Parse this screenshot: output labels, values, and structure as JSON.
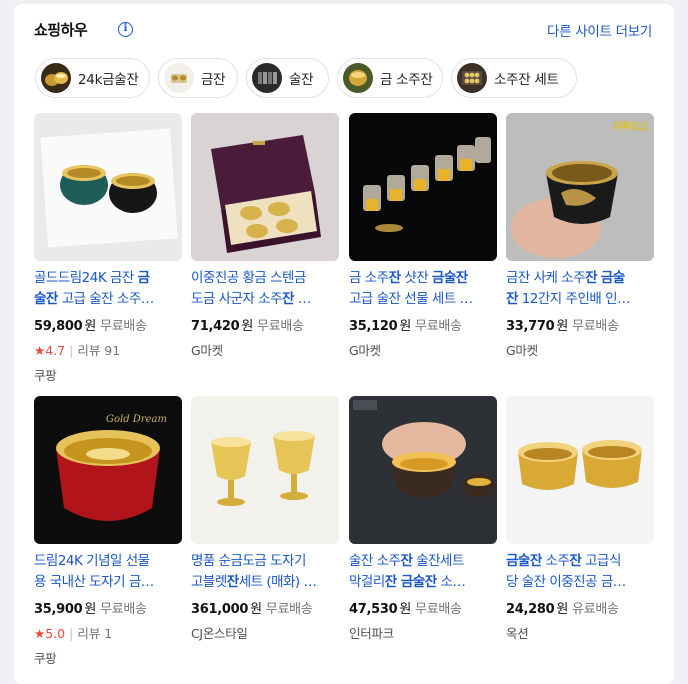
{
  "header": {
    "title": "쇼핑하우",
    "info_icon": "i",
    "more_link": "다른 사이트 더보기"
  },
  "chips": [
    {
      "label": "24k금술잔",
      "icon": "gold-cups-thumb"
    },
    {
      "label": "금잔",
      "icon": "gold-cup-thumb"
    },
    {
      "label": "술잔",
      "icon": "shot-glass-set-thumb"
    },
    {
      "label": "금 소주잔",
      "icon": "gold-soju-cup-thumb"
    },
    {
      "label": "소주잔 세트",
      "icon": "soju-set-box-thumb"
    }
  ],
  "products": [
    {
      "name_parts": [
        "골드드림24K 금잔 ",
        "금",
        "\n",
        "술잔",
        " 고급 술잔 소주잔"
      ],
      "name_line1_pre": "골드드림24K 금잔 ",
      "name_line1_bold": "금",
      "name_line2_bold": "술잔",
      "name_line2_post": " 고급 술잔 소주…",
      "price": "59,800",
      "won": "원",
      "shipping": "무료배송",
      "rating": "4.7",
      "reviews": "리뷰 91",
      "mall": "쿠팡"
    },
    {
      "name_line1_pre": "이중진공 황금 스텐금",
      "name_line1_bold": "",
      "name_line2_pre": "도금 사군자 소주",
      "name_line2_bold": "잔",
      "name_line2_post": " …",
      "price": "71,420",
      "won": "원",
      "shipping": "무료배송",
      "mall": "G마켓"
    },
    {
      "name_line1_pre": "금 소주",
      "name_line1_bold": "잔",
      "name_line1_mid": " 샷잔 ",
      "name_line1_bold2": "금술잔",
      "name_line2_post": "고급 술잔 선물 세트 …",
      "price": "35,120",
      "won": "원",
      "shipping": "무료배송",
      "mall": "G마켓"
    },
    {
      "name_line1_pre": "금잔 사케 소주",
      "name_line1_bold": "잔",
      "name_line1_mid": " ",
      "name_line1_bold2": "금술",
      "name_line2_bold": "잔",
      "name_line2_post": " 12간지 주인배 인…",
      "price": "33,770",
      "won": "원",
      "shipping": "무료배송",
      "mall": "G마켓",
      "watermark": "티투오스"
    },
    {
      "name_line1_pre": "드림24K 기념일 선물",
      "name_line2_post": "용 국내산 도자기 금…",
      "price": "35,900",
      "won": "원",
      "shipping": "무료배송",
      "rating": "5.0",
      "reviews": "리뷰 1",
      "mall": "쿠팡"
    },
    {
      "name_line1_pre": "명품 순금도금 도자기",
      "name_line2_pre": "고블렛",
      "name_line2_bold": "잔",
      "name_line2_post": "세트 (매화) …",
      "price": "361,000",
      "won": "원",
      "shipping": "무료배송",
      "mall": "CJ온스타일"
    },
    {
      "name_line1_pre": "술잔 소주",
      "name_line1_bold": "잔",
      "name_line1_mid": " 술잔세트",
      "name_line2_pre": "막걸리",
      "name_line2_bold": "잔 금술잔",
      "name_line2_post": " 소…",
      "price": "47,530",
      "won": "원",
      "shipping": "무료배송",
      "mall": "인터파크"
    },
    {
      "name_line1_bold": "금술잔",
      "name_line1_mid": " 소주",
      "name_line1_bold2": "잔",
      "name_line1_post": " 고급식",
      "name_line2_post": "당 술잔 이중진공 금…",
      "price": "24,280",
      "won": "원",
      "shipping": "유료배송",
      "mall": "옥션"
    }
  ],
  "colors": {
    "link_blue": "#1a57c7",
    "rating_red": "#e8493b",
    "gray_text": "#70757a"
  }
}
